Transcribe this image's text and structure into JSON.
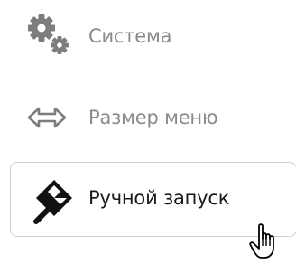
{
  "menu": {
    "items": [
      {
        "label": "Система",
        "icon": "gears-icon",
        "state": "normal"
      },
      {
        "label": "Размер меню",
        "icon": "horizontal-resize-arrow-icon",
        "state": "normal"
      },
      {
        "label": "Ручной запуск",
        "icon": "race-flag-icon",
        "state": "hover"
      }
    ]
  },
  "cursor": {
    "icon": "hand-pointer-icon"
  },
  "colors": {
    "muted_text": "#8a8a8a",
    "active_text": "#1a1a1a",
    "border": "#cfcfcf",
    "icon_muted": "#7d7d7d",
    "icon_active": "#111111"
  }
}
